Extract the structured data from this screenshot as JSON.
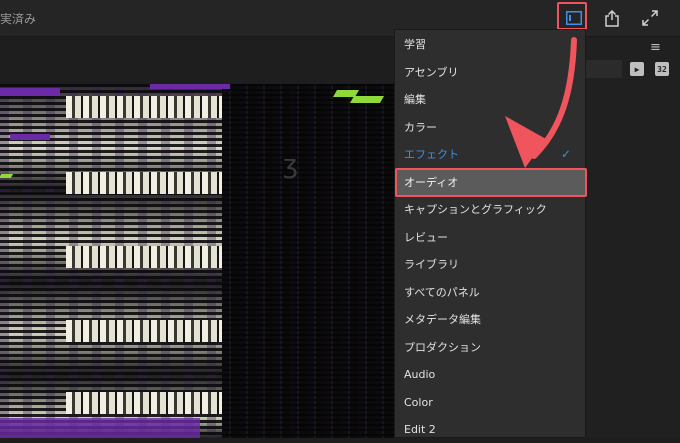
{
  "status_text": "実済み",
  "topbar": {
    "workspaces_icon": "workspaces-panel-icon",
    "share_icon": "share-icon",
    "fullscreen_icon": "fullscreen-icon"
  },
  "workspace_menu": {
    "items": [
      {
        "label": "学習"
      },
      {
        "label": "アセンブリ"
      },
      {
        "label": "編集"
      },
      {
        "label": "カラー"
      },
      {
        "label": "エフェクト",
        "checked": true
      },
      {
        "label": "オーディオ",
        "selected": true
      },
      {
        "label": "キャプションとグラフィック"
      },
      {
        "label": "レビュー"
      },
      {
        "label": "ライブラリ"
      },
      {
        "label": "すべてのパネル"
      },
      {
        "label": "メタデータ編集"
      },
      {
        "label": "プロダクション"
      },
      {
        "label": "Audio"
      },
      {
        "label": "Color"
      },
      {
        "label": "Edit 2"
      }
    ]
  },
  "right_panel": {
    "menu_icon": "hamburger-menu-icon",
    "icon_a": "add-marker-icon",
    "icon_b": "number-32-icon",
    "icon_b_text": "32"
  },
  "colors": {
    "highlight": "#f0555e",
    "checked_accent": "#3d8ee6",
    "selected_bg": "#5b5b5b"
  }
}
